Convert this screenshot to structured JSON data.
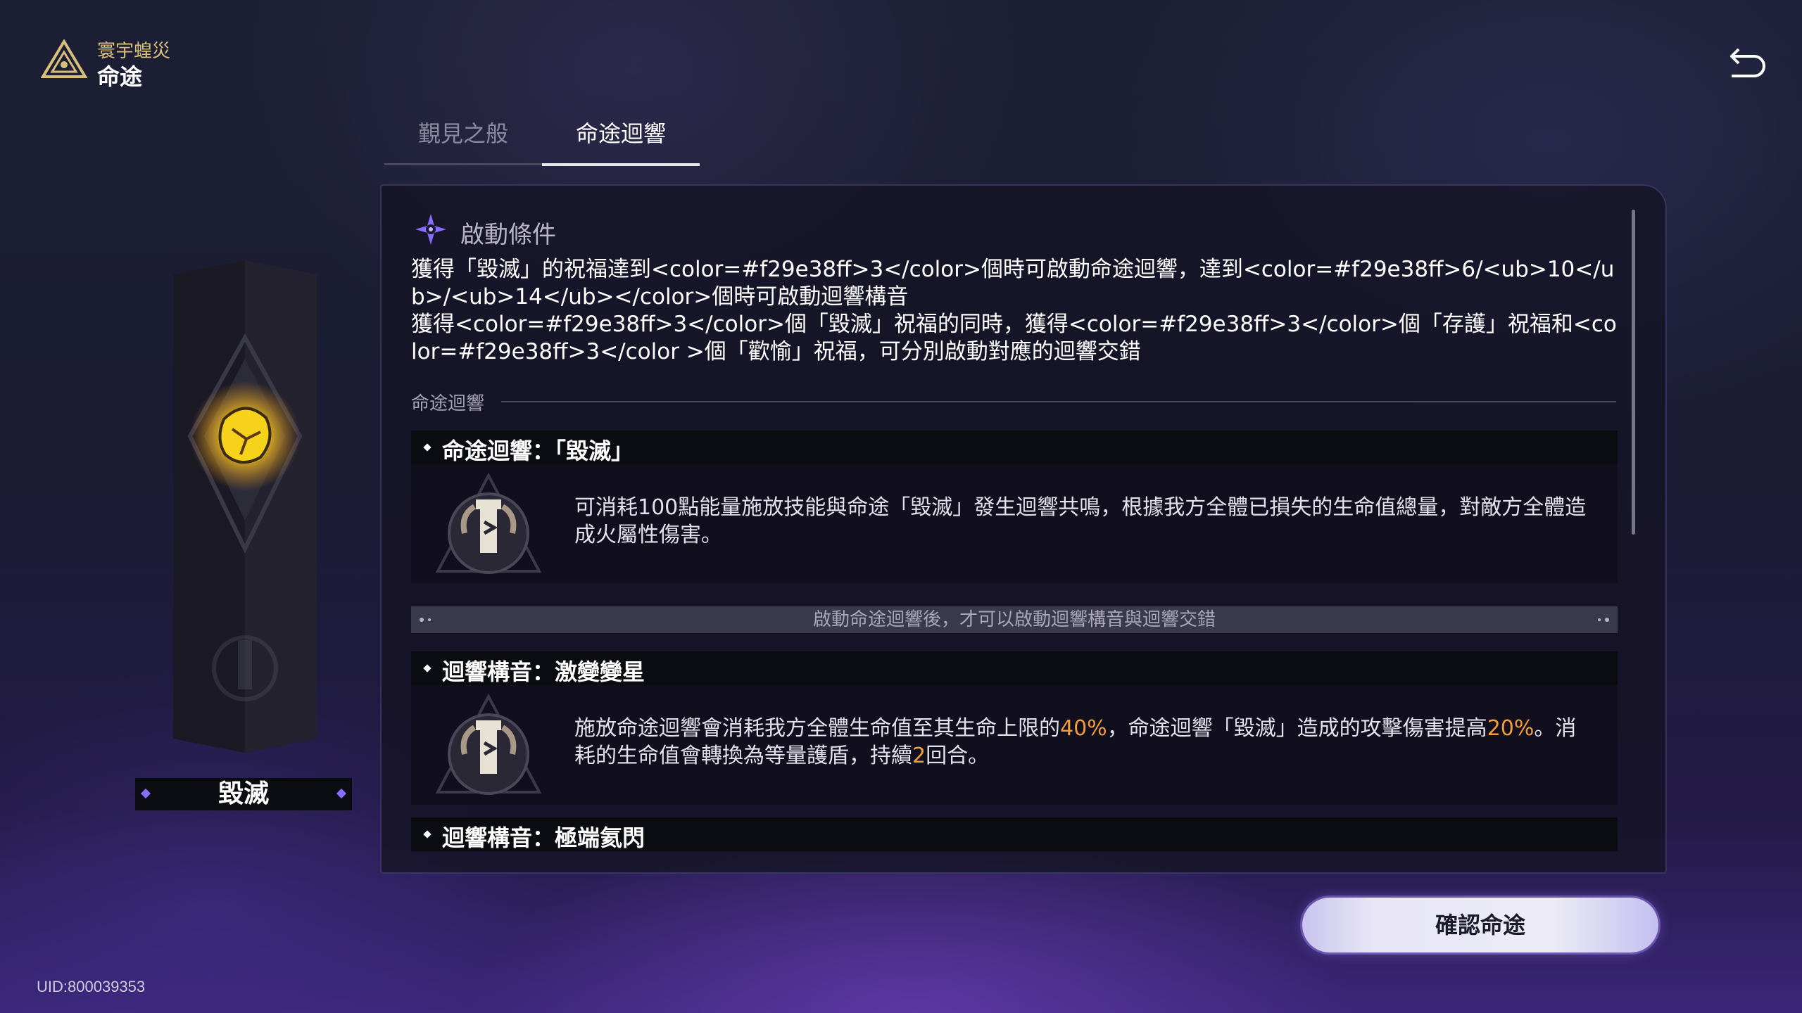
{
  "header": {
    "subtitle": "寰宇蝗災",
    "title": "命途",
    "logo_icon": "path-triangle-icon",
    "back_icon": "return-arrow-icon"
  },
  "tabs": [
    {
      "label": "覲見之般",
      "active": false
    },
    {
      "label": "命途迴響",
      "active": true
    }
  ],
  "path": {
    "name": "毀滅",
    "emblem_icon": "destruction-crystal-icon"
  },
  "conditions": {
    "title": "啟動條件",
    "icon": "starburst-icon",
    "line1": "獲得「毀滅」的祝福達到<color=#f29e38ff>3</color>個時可啟動命途迴響，達到<color=#f29e38ff>6/<ub>10</ub>/<ub>14</ub></color>個時可啟動迴響構音",
    "line2": "獲得<color=#f29e38ff>3</color>個「毀滅」祝福的同時，獲得<color=#f29e38ff>3</color>個「存護」祝福和<color=#f29e38ff>3</color >個「歡愉」祝福，可分別啟動對應的迴響交錯"
  },
  "resonance_section": {
    "label": "命途迴響",
    "items": [
      {
        "title": "命途迴響：「毀滅」",
        "icon": "destruction-emblem-icon",
        "desc": "可消耗100點能量施放技能與命途「毀滅」發生迴響共鳴，根據我方全體已損失的生命值總量，對敵方全體造成火屬性傷害。"
      },
      {
        "title": "迴響構音：激變變星",
        "icon": "destruction-emblem-icon",
        "desc_parts": [
          "施放命途迴響會消耗我方全體生命值至其生命上限的",
          "40%",
          "，命途迴響「毀滅」造成的攻擊傷害提高",
          "20%",
          "。消耗的生命值會轉換為等量護盾，持續",
          "2",
          "回合。"
        ]
      },
      {
        "title": "迴響構音：極端氦閃"
      }
    ],
    "notice": "啟動命途迴響後，才可以啟動迴響構音與迴響交錯"
  },
  "confirm_label": "確認命途",
  "uid": "UID:800039353",
  "colors": {
    "highlight": "#f29e38",
    "accent": "#8a6cff"
  }
}
